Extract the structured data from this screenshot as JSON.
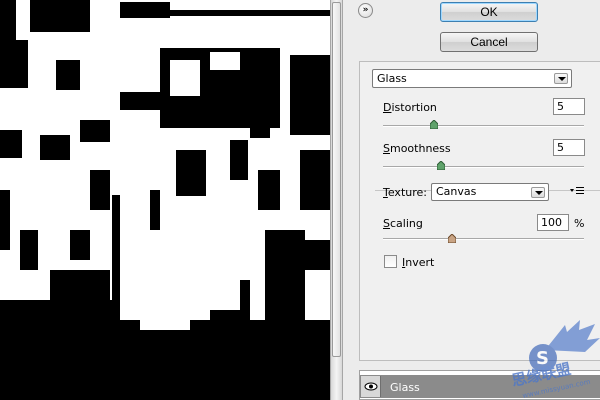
{
  "buttons": {
    "ok": "OK",
    "cancel": "Cancel"
  },
  "filter": {
    "selected": "Glass"
  },
  "distortion": {
    "label": "Distortion",
    "value": "5"
  },
  "smoothness": {
    "label": "Smoothness",
    "value": "5"
  },
  "texture": {
    "label": "Texture:",
    "selected": "Canvas"
  },
  "scaling": {
    "label": "Scaling",
    "value": "100",
    "unit": "%"
  },
  "invert": {
    "label": "Invert",
    "checked": false
  },
  "layers": [
    {
      "name": "Glass",
      "visible": true
    }
  ],
  "watermark": {
    "brand_cn": "思缘联盟",
    "url": "www.missyuan.com"
  },
  "icons": {
    "collapse": "double-chevron-icon",
    "menu": "panel-menu-icon",
    "eye": "eye-icon"
  },
  "colors": {
    "ok_border": "#3c7fb1",
    "layer_row": "#8b8b8b"
  }
}
